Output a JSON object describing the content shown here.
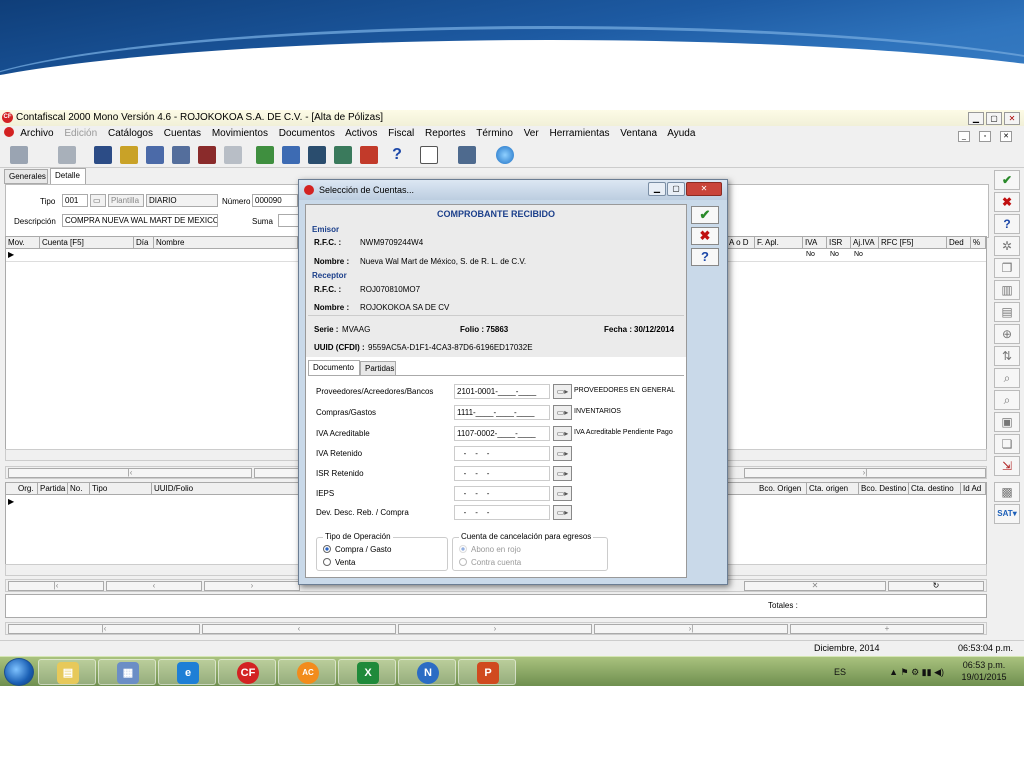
{
  "app": {
    "title": "Contafiscal 2000 Mono Versión 4.6 - ROJOKOKOA S.A. DE C.V. - [Alta de Pólizas]",
    "logo_text": "CF",
    "menu": [
      "Archivo",
      "Edición",
      "Catálogos",
      "Cuentas",
      "Movimientos",
      "Documentos",
      "Activos",
      "Fiscal",
      "Reportes",
      "Término",
      "Ver",
      "Herramientas",
      "Ventana",
      "Ayuda"
    ],
    "menu_disabled": [
      "Edición"
    ]
  },
  "tabs": [
    "Generales",
    "Detalle"
  ],
  "header_form": {
    "tipo_label": "Tipo",
    "tipo_value": "001",
    "plantilla_label": "Plantilla",
    "tipo_name": "DIARIO",
    "numero_label": "Número",
    "numero_value": "000090",
    "descripcion_label": "Descripción",
    "descripcion_value": "COMPRA NUEVA WAL MART DE MEXICO",
    "suma_label": "Suma"
  },
  "grid1": {
    "columns_left": [
      "Mov.",
      "Cuenta [F5]",
      "Día",
      "Nombre"
    ],
    "columns_right": [
      "A o D",
      "F. Apl.",
      "IVA",
      "ISR",
      "Aj.IVA",
      "RFC [F5]",
      "Ded",
      "%"
    ],
    "row_values": [
      "No",
      "No",
      "No"
    ]
  },
  "grid2": {
    "columns_left": [
      "Org.",
      "Partida",
      "No.",
      "Tipo",
      "UUID/Folio"
    ],
    "columns_right": [
      "Bco. Origen",
      "Cta. origen",
      "Bco. Destino",
      "Cta. destino",
      "Id Ad"
    ]
  },
  "totales_label": "Totales :",
  "status": {
    "period": "Diciembre, 2014",
    "time": "06:53:04 p.m."
  },
  "taskbar": {
    "apps": [
      {
        "label": "",
        "color": "#e7c95a",
        "glyph": "▤"
      },
      {
        "label": "",
        "color": "#6b8ec6",
        "glyph": "▦"
      },
      {
        "label": "",
        "color": "#1e7fd6",
        "glyph": "e"
      },
      {
        "label": "",
        "color": "#d32222",
        "glyph": "CF"
      },
      {
        "label": "",
        "color": "#f28c1c",
        "glyph": "AC"
      },
      {
        "label": "",
        "color": "#1f8a3a",
        "glyph": "X"
      },
      {
        "label": "",
        "color": "#2b6cc4",
        "glyph": "N"
      },
      {
        "label": "",
        "color": "#d04a1f",
        "glyph": "P"
      }
    ],
    "lang": "ES",
    "clock_time": "06:53 p.m.",
    "clock_date": "19/01/2015"
  },
  "dialog": {
    "title": "Selección de Cuentas...",
    "header": "COMPROBANTE RECIBIDO",
    "emisor_label": "Emisor",
    "rfc_label": "R.F.C. :",
    "emisor_rfc": "NWM9709244W4",
    "nombre_label": "Nombre :",
    "emisor_nombre": "Nueva Wal Mart de México, S. de R. L. de C.V.",
    "receptor_label": "Receptor",
    "receptor_rfc": "ROJ070810MO7",
    "receptor_nombre": "ROJOKOKOA SA DE CV",
    "serie_label": "Serie :",
    "serie_value": "MVAAG",
    "folio_label": "Folio :",
    "folio_value": "75863",
    "fecha_label": "Fecha :",
    "fecha_value": "30/12/2014",
    "uuid_label": "UUID (CFDI) :",
    "uuid_value": "9559AC5A-D1F1-4CA3-87D6-6196ED17032E",
    "tabs": [
      "Documento",
      "Partidas"
    ],
    "rows": [
      {
        "label": "Proveedores/Acreedores/Bancos",
        "value": "2101-0001-____-____",
        "desc": "PROVEEDORES EN GENERAL"
      },
      {
        "label": "Compras/Gastos",
        "value": "1111-____-____-____",
        "desc": "INVENTARIOS"
      },
      {
        "label": "IVA Acreditable",
        "value": "1107-0002-____-____",
        "desc": "IVA Acreditable Pendiente Pago"
      },
      {
        "label": "IVA Retenido",
        "value": "   -    -    -",
        "desc": ""
      },
      {
        "label": "ISR Retenido",
        "value": "   -    -    -",
        "desc": ""
      },
      {
        "label": "IEPS",
        "value": "   -    -    -",
        "desc": ""
      },
      {
        "label": "Dev. Desc. Reb. / Compra",
        "value": "   -    -    -",
        "desc": ""
      }
    ],
    "tipo_operacion_label": "Tipo de Operación",
    "op_compra": "Compra / Gasto",
    "op_venta": "Venta",
    "cancelacion_label": "Cuenta de cancelación para egresos",
    "cancel_abono": "Abono en rojo",
    "cancel_contra": "Contra cuenta"
  }
}
